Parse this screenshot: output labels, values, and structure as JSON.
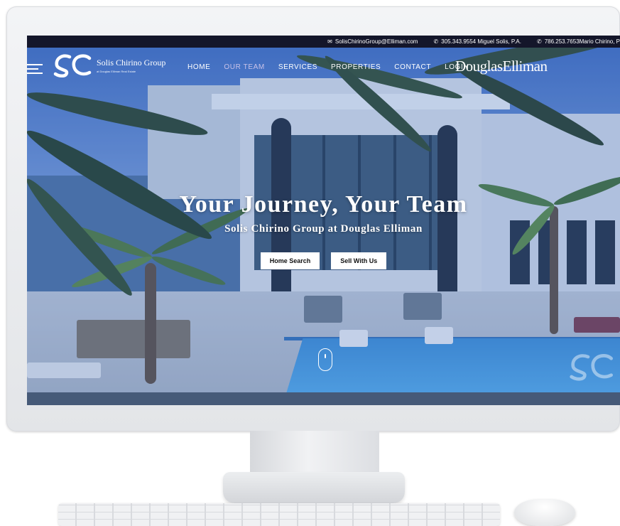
{
  "topbar": {
    "email": "SolisChirinoGroup@Elliman.com",
    "phone1": "305.343.9554 Miguel Solis, P.A.",
    "phone2": "786.253.7653Mario Chirino, P"
  },
  "logo": {
    "name": "Solis Chirino Group",
    "sub": "at Douglas Elliman Real Estate"
  },
  "nav": {
    "items": [
      "HOME",
      "OUR TEAM",
      "SERVICES",
      "PROPERTIES",
      "CONTACT",
      "LOGIN"
    ],
    "active": "OUR TEAM"
  },
  "brand": "DouglasElliman",
  "hero": {
    "title": "Your Journey, Your Team",
    "subtitle": "Solis Chirino Group at Douglas Elliman",
    "buttons": {
      "home_search": "Home Search",
      "sell_with_us": "Sell With Us"
    }
  },
  "icons": {
    "email": "email-icon",
    "phone": "phone-icon",
    "menu": "hamburger-icon",
    "scroll": "scroll-down-icon"
  },
  "colors": {
    "topbar": "#14162a",
    "nav_active": "#c9c2e8",
    "overlay": "#466ebe"
  }
}
